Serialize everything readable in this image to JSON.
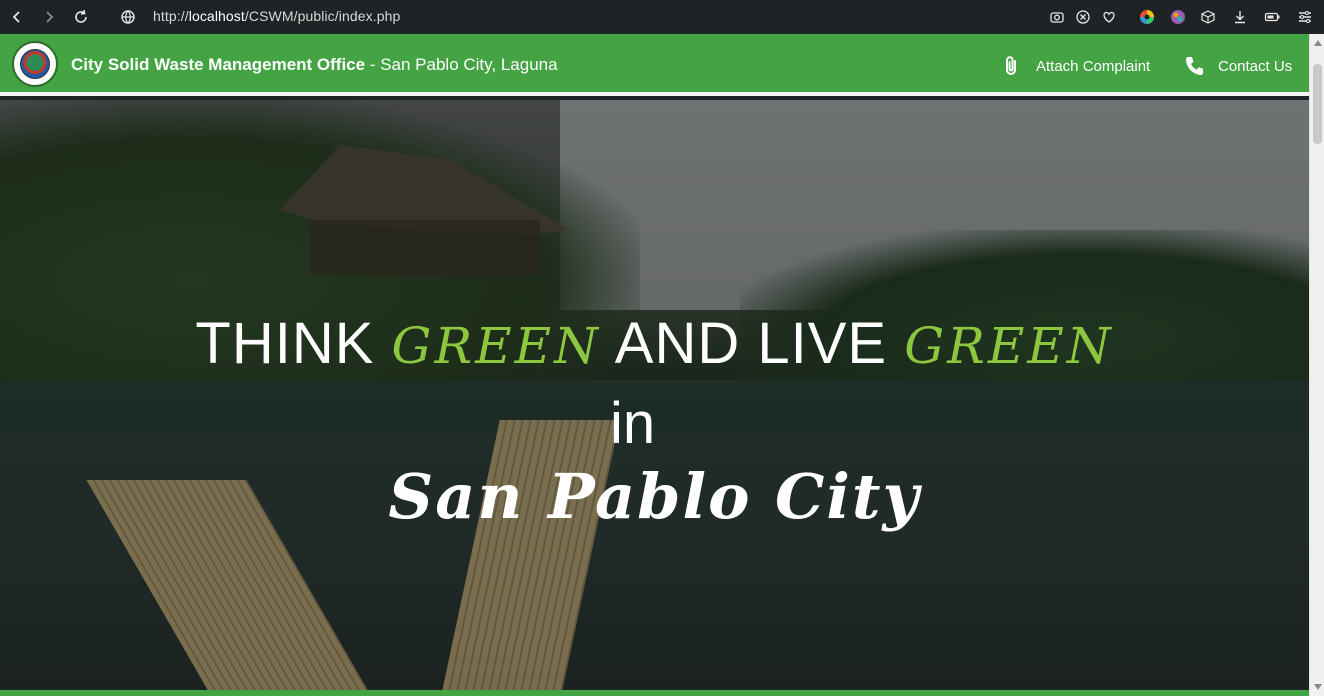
{
  "browser": {
    "url_prefix": "http://",
    "url_host": "localhost",
    "url_path": "/CSWM/public/index.php",
    "icons": [
      "back-icon",
      "forward-icon",
      "reload-icon",
      "site-info-icon",
      "camera-icon",
      "shield-icon",
      "heart-icon",
      "color-wheel-icon",
      "palette-icon",
      "cube-icon",
      "download-icon",
      "battery-icon",
      "menu-icon"
    ]
  },
  "header": {
    "brand_bold": "City Solid Waste Management Office",
    "brand_suffix": " - San Pablo City, Laguna",
    "nav": [
      {
        "label": "Attach Complaint",
        "icon": "paperclip-icon"
      },
      {
        "label": "Contact Us",
        "icon": "phone-icon"
      }
    ],
    "colors": {
      "header_bg": "#44a444",
      "accent_green": "#8dc63f"
    }
  },
  "hero": {
    "think": "THINK ",
    "green1": "GREEN",
    "and_live": " AND LIVE ",
    "green2": "GREEN",
    "in": "in",
    "city": "San Pablo City"
  }
}
